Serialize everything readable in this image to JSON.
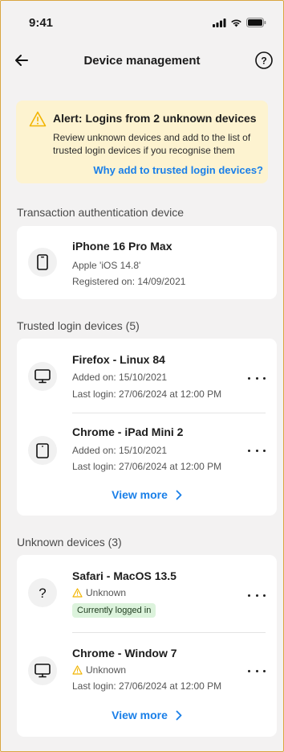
{
  "status_bar": {
    "time": "9:41"
  },
  "header": {
    "title": "Device management"
  },
  "alert": {
    "title": "Alert: Logins from 2 unknown devices",
    "body": "Review unknown devices and add to the list of trusted login devices if you recognise them",
    "link": "Why add to trusted login devices?"
  },
  "transaction": {
    "title": "Transaction authentication device",
    "device": {
      "name": "iPhone 16 Pro Max",
      "os": "Apple 'iOS 14.8'",
      "registered": "Registered on: 14/09/2021",
      "icon": "phone-icon"
    }
  },
  "trusted": {
    "title": "Trusted login devices (5)",
    "devices": [
      {
        "name": "Firefox - Linux 84",
        "added": "Added on: 15/10/2021",
        "last_login": "Last login: 27/06/2024 at 12:00 PM",
        "icon": "desktop-icon"
      },
      {
        "name": "Chrome - iPad Mini 2",
        "added": "Added on: 15/10/2021",
        "last_login": "Last login: 27/06/2024 at 12:00 PM",
        "icon": "tablet-icon"
      }
    ],
    "view_more": "View more"
  },
  "unknown": {
    "title": "Unknown devices (3)",
    "devices": [
      {
        "name": "Safari - MacOS 13.5",
        "status": "Unknown",
        "badge": "Currently logged in",
        "icon": "question-icon"
      },
      {
        "name": "Chrome - Window 7",
        "status": "Unknown",
        "last_login": "Last login: 27/06/2024 at 12:00 PM",
        "icon": "desktop-icon"
      }
    ],
    "view_more": "View more"
  },
  "colors": {
    "accent": "#1a7fe8",
    "alert_bg": "#fdf3d0",
    "warning": "#f2b400",
    "badge_bg": "#dcf3dc"
  }
}
